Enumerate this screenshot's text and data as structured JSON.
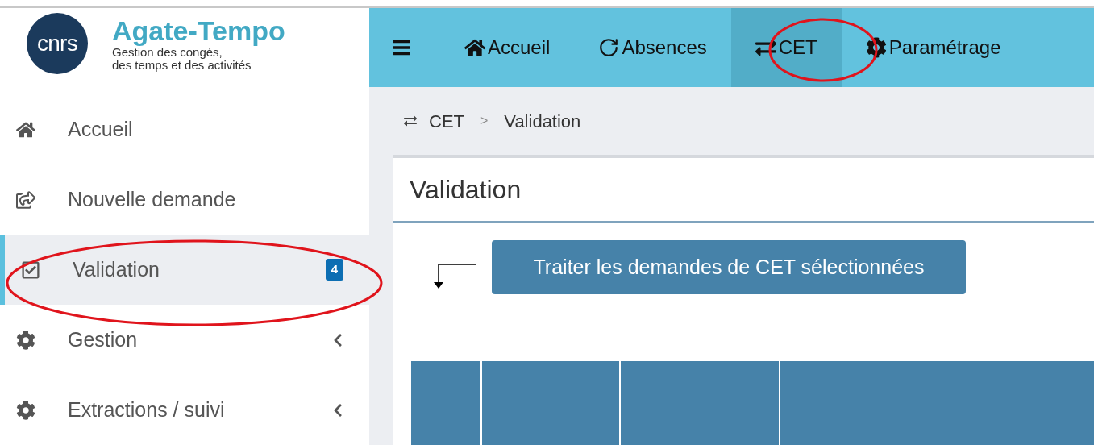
{
  "brand": {
    "logo": "cnrs",
    "name": "Agate-Tempo",
    "subtitle": [
      "Gestion des congés,",
      "des temps et des activités"
    ]
  },
  "topnav": [
    {
      "label": "Accueil",
      "selected": false
    },
    {
      "label": "Absences",
      "selected": false
    },
    {
      "label": "CET",
      "selected": true
    },
    {
      "label": "Paramétrage",
      "selected": false
    }
  ],
  "sidebar": {
    "items": [
      {
        "label": "Accueil",
        "selected": false,
        "has_submenu": false
      },
      {
        "label": "Nouvelle demande",
        "selected": false,
        "has_submenu": false
      },
      {
        "label": "Validation",
        "selected": true,
        "has_submenu": false,
        "badge": "4"
      },
      {
        "label": "Gestion",
        "selected": false,
        "has_submenu": true
      },
      {
        "label": "Extractions / suivi",
        "selected": false,
        "has_submenu": true
      }
    ]
  },
  "breadcrumb": [
    "CET",
    "Validation"
  ],
  "breadcrumb_separator": ">",
  "page": {
    "title": "Validation",
    "action_button": "Traiter les demandes de CET sélectionnées"
  }
}
